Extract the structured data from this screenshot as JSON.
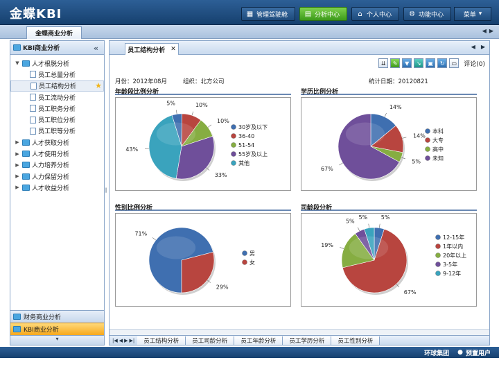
{
  "app": {
    "logo": "金蝶KBI"
  },
  "topnav": [
    {
      "label": "管理驾驶舱",
      "icon": "dashboard-icon",
      "active": false
    },
    {
      "label": "分析中心",
      "icon": "chart-icon",
      "active": true
    },
    {
      "label": "个人中心",
      "icon": "home-icon",
      "active": false
    },
    {
      "label": "功能中心",
      "icon": "gear-icon",
      "active": false
    }
  ],
  "menu_label": "菜单",
  "main_tab": "金蝶商业分析",
  "sidebar": {
    "title": "KBI商业分析",
    "items": [
      {
        "label": "人才根脱分析",
        "level": 0,
        "expanded": true
      },
      {
        "label": "员工总量分析",
        "level": 1
      },
      {
        "label": "员工结构分析",
        "level": 1,
        "selected": true,
        "starred": true
      },
      {
        "label": "员工流动分析",
        "level": 1
      },
      {
        "label": "员工职务分析",
        "level": 1
      },
      {
        "label": "员工职位分析",
        "level": 1
      },
      {
        "label": "员工职等分析",
        "level": 1
      },
      {
        "label": "人才获取分析",
        "level": 0
      },
      {
        "label": "人才使用分析",
        "level": 0
      },
      {
        "label": "人力培养分析",
        "level": 0
      },
      {
        "label": "人力保留分析",
        "level": 0
      },
      {
        "label": "人才收益分析",
        "level": 0
      }
    ],
    "footer_items": [
      "财务商业分析",
      "KBI商业分析"
    ]
  },
  "content_tab": "员工结构分析",
  "toolbar": {
    "comment_label": "评论(0)"
  },
  "info": {
    "month": "月份：2012年08月",
    "org": "组织：北方公司",
    "date": "统计日期：20120821"
  },
  "chart_data": [
    {
      "type": "pie",
      "title": "年龄段比例分析",
      "categories": [
        "30岁及以下",
        "36-40",
        "51-54",
        "55岁及以上",
        "其他"
      ],
      "values": [
        5,
        10,
        10,
        33,
        43
      ],
      "colors": [
        "#3f6fb0",
        "#b8453f",
        "#86ad42",
        "#6f4f9a",
        "#3aa3bd"
      ]
    },
    {
      "type": "pie",
      "title": "学历比例分析",
      "categories": [
        "本科",
        "大专",
        "高中",
        "未知"
      ],
      "values": [
        14,
        14,
        5,
        67
      ],
      "colors": [
        "#3f6fb0",
        "#b8453f",
        "#86ad42",
        "#6f4f9a"
      ]
    },
    {
      "type": "pie",
      "title": "性别比例分析",
      "categories": [
        "男",
        "女"
      ],
      "values": [
        71,
        29
      ],
      "colors": [
        "#3f6fb0",
        "#b8453f"
      ]
    },
    {
      "type": "pie",
      "title": "司龄段分析",
      "categories": [
        "12-15年",
        "1年以内",
        "20年以上",
        "3-5年",
        "9-12年"
      ],
      "values": [
        5,
        67,
        19,
        5,
        5
      ],
      "colors": [
        "#3f6fb0",
        "#b8453f",
        "#86ad42",
        "#6f4f9a",
        "#3aa3bd"
      ]
    }
  ],
  "bottom_tabs": [
    "员工结构分析",
    "员工司龄分析",
    "员工年龄分析",
    "员工学历分析",
    "员工性别分析"
  ],
  "status": {
    "company": "环球集团",
    "user": "预置用户"
  }
}
